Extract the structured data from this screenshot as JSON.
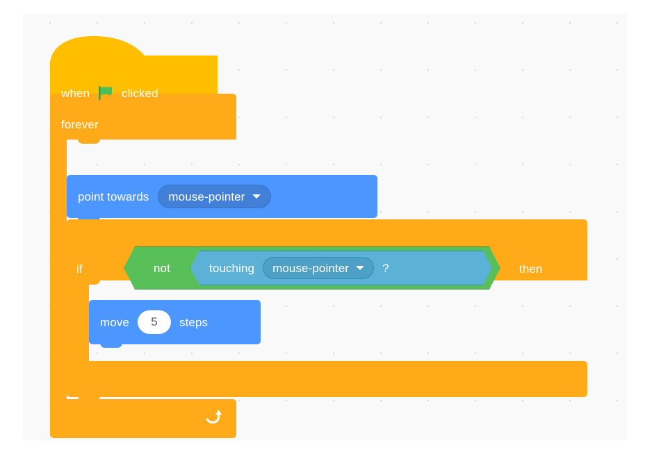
{
  "workspace": {
    "name": "scratch-block-workspace",
    "background_color": "#f9f9f9",
    "grid_dot_color": "#d9d9d9"
  },
  "palette": {
    "events_yellow": "#FFBF00",
    "control_orange": "#FFAB19",
    "motion_blue": "#4C97FF",
    "motion_field_blue": "#4280D7",
    "sensing_blue": "#5CB1D6",
    "sensing_field_blue": "#4DA1C6",
    "operators_green": "#59C059",
    "input_white": "#ffffff",
    "input_text": "#575E75",
    "block_text": "#ffffff"
  },
  "script": {
    "hat": {
      "category": "events",
      "text_before": "when",
      "icon": "green-flag-icon",
      "text_after": "clicked"
    },
    "forever": {
      "category": "control",
      "label": "forever",
      "loop_icon": "loop-arrow-icon"
    },
    "point_towards": {
      "category": "motion",
      "label": "point towards",
      "dropdown_value": "mouse-pointer",
      "dropdown_icon": "chevron-down-icon"
    },
    "if_then": {
      "category": "control",
      "label_if": "if",
      "label_then": "then"
    },
    "not_operator": {
      "category": "operators",
      "label": "not"
    },
    "touching": {
      "category": "sensing",
      "label": "touching",
      "dropdown_value": "mouse-pointer",
      "dropdown_icon": "chevron-down-icon",
      "suffix": "?"
    },
    "move": {
      "category": "motion",
      "label_before": "move",
      "value": "5",
      "label_after": "steps"
    }
  }
}
